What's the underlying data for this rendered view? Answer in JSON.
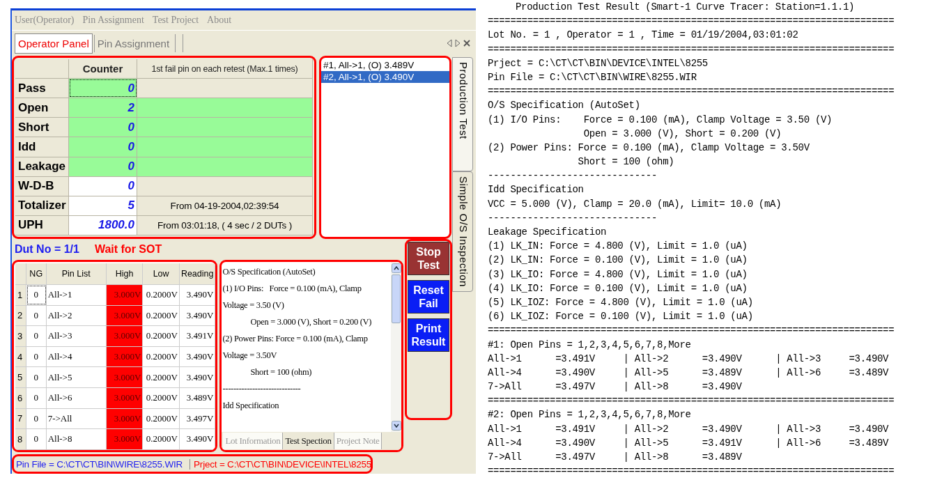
{
  "window": {
    "menu": [
      {
        "label": "User(Operator)",
        "disabled": true
      },
      {
        "label": "Pin Assignment",
        "disabled": true
      },
      {
        "label": "Test Project",
        "disabled": true
      },
      {
        "label": "About",
        "disabled": true
      }
    ],
    "tabs": [
      {
        "label": "Operator Panel",
        "selected": true
      },
      {
        "label": "Pin Assignment",
        "selected": false
      }
    ],
    "side_tabs": [
      {
        "label": "Production Test",
        "selected": true
      },
      {
        "label": "Simple O/S Inspection",
        "selected": false
      }
    ]
  },
  "counter_table": {
    "columns": [
      "Counter",
      "1st fail pin on each retest (Max.1 times)"
    ],
    "rows": [
      {
        "label": "Pass",
        "counter": "0",
        "counter_fill": true,
        "fail_fill": false,
        "focused": true
      },
      {
        "label": "Open",
        "counter": "2",
        "counter_fill": true,
        "fail_fill": true,
        "focused": false
      },
      {
        "label": "Short",
        "counter": "0",
        "counter_fill": true,
        "fail_fill": true,
        "focused": false
      },
      {
        "label": "Idd",
        "counter": "0",
        "counter_fill": true,
        "fail_fill": true,
        "focused": false
      },
      {
        "label": "Leakage",
        "counter": "0",
        "counter_fill": true,
        "fail_fill": true,
        "focused": false
      },
      {
        "label": "W-D-B",
        "counter": "0",
        "counter_fill": false,
        "fail_fill": false,
        "focused": false
      },
      {
        "label": "Totalizer",
        "counter": "5",
        "counter_fill": false,
        "fail_fill": false,
        "focused": false,
        "note": "From 04-19-2004,02:39:54"
      },
      {
        "label": "UPH",
        "counter": "1800.0",
        "counter_fill": false,
        "fail_fill": false,
        "focused": false,
        "note": "From 03:01:18, ( 4 sec / 2 DUTs )"
      }
    ]
  },
  "fail_list": [
    {
      "text": "#1, All->1, (O) 3.489V",
      "selected": false
    },
    {
      "text": "#2, All->1, (O) 3.490V",
      "selected": true
    }
  ],
  "dut": {
    "number": "Dut No = 1/1",
    "status": "Wait for SOT"
  },
  "pin_table": {
    "columns": [
      "NG",
      "Pin List",
      "High",
      "Low",
      "Reading"
    ],
    "rows": [
      {
        "index": "1",
        "ng": "0",
        "pins": "All->1",
        "high": "3.000V",
        "low": "0.2000V",
        "reading": "3.490V",
        "high_fail": true,
        "focused": true
      },
      {
        "index": "2",
        "ng": "0",
        "pins": "All->2",
        "high": "3.000V",
        "low": "0.2000V",
        "reading": "3.490V",
        "high_fail": true,
        "focused": false
      },
      {
        "index": "3",
        "ng": "0",
        "pins": "All->3",
        "high": "3.000V",
        "low": "0.2000V",
        "reading": "3.491V",
        "high_fail": true,
        "focused": false
      },
      {
        "index": "4",
        "ng": "0",
        "pins": "All->4",
        "high": "3.000V",
        "low": "0.2000V",
        "reading": "3.490V",
        "high_fail": true,
        "focused": false
      },
      {
        "index": "5",
        "ng": "0",
        "pins": "All->5",
        "high": "3.000V",
        "low": "0.2000V",
        "reading": "3.490V",
        "high_fail": true,
        "focused": false
      },
      {
        "index": "6",
        "ng": "0",
        "pins": "All->6",
        "high": "3.000V",
        "low": "0.2000V",
        "reading": "3.489V",
        "high_fail": true,
        "focused": false
      },
      {
        "index": "7",
        "ng": "0",
        "pins": "7->All",
        "high": "3.000V",
        "low": "0.2000V",
        "reading": "3.497V",
        "high_fail": true,
        "focused": false
      },
      {
        "index": "8",
        "ng": "0",
        "pins": "All->8",
        "high": "3.000V",
        "low": "0.2000V",
        "reading": "3.490V",
        "high_fail": true,
        "focused": false
      }
    ]
  },
  "spec_panel": {
    "lines": [
      {
        "text": "O/S Specification (AutoSet)",
        "indent": false
      },
      {
        "text": "(1) I/O Pins:   Force = 0.100 (mA), Clamp",
        "indent": false
      },
      {
        "text": "Voltage = 3.50 (V)",
        "indent": false
      },
      {
        "text": "Open = 3.000 (V), Short = 0.200 (V)",
        "indent": true
      },
      {
        "text": "(2) Power Pins: Force = 0.100 (mA), Clamp",
        "indent": false
      },
      {
        "text": "Voltage = 3.50V",
        "indent": false
      },
      {
        "text": "Short = 100 (ohm)",
        "indent": true
      },
      {
        "text": "-----------------------------",
        "indent": false
      },
      {
        "text": "Idd Specification",
        "indent": false
      }
    ],
    "tabs": [
      {
        "label": "Lot Information",
        "selected": false
      },
      {
        "label": "Test Spection",
        "selected": true
      },
      {
        "label": "Project Note",
        "selected": false
      }
    ]
  },
  "buttons": [
    {
      "label": "Stop Test",
      "kind": "stop"
    },
    {
      "label": "Reset Fail",
      "kind": "action"
    },
    {
      "label": "Print Result",
      "kind": "action"
    }
  ],
  "status_bar": {
    "pin_file": "Pin File = C:\\CT\\CT\\BIN\\WIRE\\8255.WIR",
    "project": "Prject = C:\\CT\\CT\\BIN\\DEVICE\\INTEL\\8255"
  },
  "report": {
    "lines": [
      {
        "kind": "title",
        "text": "Production Test Result (Smart-1 Curve Tracer: Station=1.1.1)"
      },
      {
        "kind": "text",
        "text": "========================================================================"
      },
      {
        "kind": "text",
        "text": "Lot No. = 1 , Operator = 1 , Time = 01/19/2004,03:01:02"
      },
      {
        "kind": "text",
        "text": "========================================================================"
      },
      {
        "kind": "text",
        "text": "Prject = C:\\CT\\CT\\BIN\\DEVICE\\INTEL\\8255"
      },
      {
        "kind": "text",
        "text": "Pin File = C:\\CT\\CT\\BIN\\WIRE\\8255.WIR"
      },
      {
        "kind": "text",
        "text": "========================================================================"
      },
      {
        "kind": "text",
        "text": "O/S Specification (AutoSet)"
      },
      {
        "kind": "text",
        "text": "(1) I/O Pins:    Force = 0.100 (mA), Clamp Voltage = 3.50 (V)"
      },
      {
        "kind": "text",
        "text": "                 Open = 3.000 (V), Short = 0.200 (V)"
      },
      {
        "kind": "text",
        "text": "(2) Power Pins: Force = 0.100 (mA), Clamp Voltage = 3.50V"
      },
      {
        "kind": "text",
        "text": "                Short = 100 (ohm)"
      },
      {
        "kind": "text",
        "text": "------------------------------"
      },
      {
        "kind": "text",
        "text": "Idd Specification"
      },
      {
        "kind": "text",
        "text": "VCC = 5.000 (V), Clamp = 20.0 (mA), Limit= 10.0 (mA)"
      },
      {
        "kind": "text",
        "text": "------------------------------"
      },
      {
        "kind": "text",
        "text": "Leakage Specification"
      },
      {
        "kind": "text",
        "text": "(1) LK_IN: Force = 4.800 (V), Limit = 1.0 (uA)"
      },
      {
        "kind": "text",
        "text": "(2) LK_IN: Force = 0.100 (V), Limit = 1.0 (uA)"
      },
      {
        "kind": "text",
        "text": "(3) LK_IO: Force = 4.800 (V), Limit = 1.0 (uA)"
      },
      {
        "kind": "text",
        "text": "(4) LK_IO: Force = 0.100 (V), Limit = 1.0 (uA)"
      },
      {
        "kind": "text",
        "text": "(5) LK_IOZ: Force = 4.800 (V), Limit = 1.0 (uA)"
      },
      {
        "kind": "text",
        "text": "(6) LK_IOZ: Force = 0.100 (V), Limit = 1.0 (uA)"
      },
      {
        "kind": "text",
        "text": "========================================================================"
      },
      {
        "kind": "text",
        "text": "#1: Open Pins = 1,2,3,4,5,6,7,8,More"
      },
      {
        "kind": "text",
        "text": "All->1      =3.491V     | All->2      =3.490V      | All->3     =3.490V"
      },
      {
        "kind": "text",
        "text": "All->4      =3.490V     | All->5      =3.489V      | All->6     =3.489V"
      },
      {
        "kind": "text",
        "text": "7->All      =3.497V     | All->8      =3.490V"
      },
      {
        "kind": "text",
        "text": "========================================================================"
      },
      {
        "kind": "text",
        "text": "#2: Open Pins = 1,2,3,4,5,6,7,8,More"
      },
      {
        "kind": "text",
        "text": "All->1      =3.491V     | All->2      =3.490V      | All->3     =3.490V"
      },
      {
        "kind": "text",
        "text": "All->4      =3.490V     | All->5      =3.491V      | All->6     =3.489V"
      },
      {
        "kind": "text",
        "text": "7->All      =3.497V     | All->8      =3.489V"
      },
      {
        "kind": "text",
        "text": "========================================================================"
      }
    ]
  }
}
